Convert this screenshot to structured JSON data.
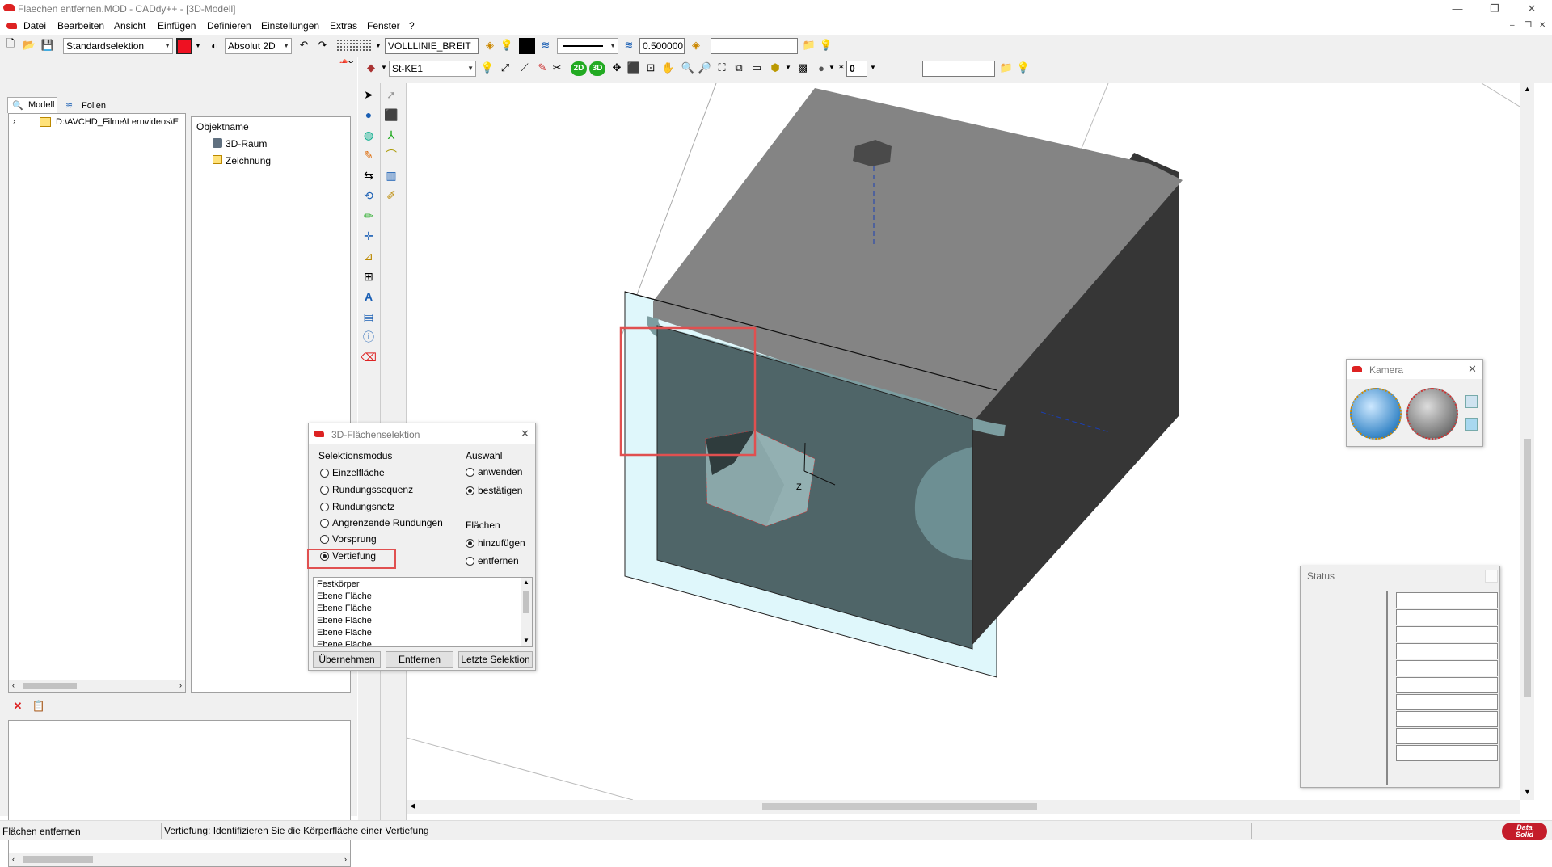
{
  "titlebar": {
    "title": "Flaechen entfernen.MOD  -  CADdy++ - [3D-Modell]",
    "minimize": "—",
    "restore": "❐",
    "close": "✕"
  },
  "menu": [
    "Datei",
    "Bearbeiten",
    "Ansicht",
    "Einfügen",
    "Definieren",
    "Einstellungen",
    "Extras",
    "Fenster",
    "?"
  ],
  "mdi": {
    "minimize": "–",
    "restore": "❐",
    "close": "✕"
  },
  "toolbar1": {
    "selection_mode": "Standardselektion",
    "coord_mode": "Absolut 2D",
    "linetype": "VOLLLINIE_BREIT",
    "linewidth": "0.500000",
    "text_field": ""
  },
  "toolbar2": {
    "layer": "St-KE1",
    "view2d": "2D",
    "view3d": "3D",
    "number": "0",
    "text_field": ""
  },
  "leftpanel": {
    "tabs": [
      "Modell",
      "Folien"
    ],
    "tree_path": "D:\\AVCHD_Filme\\Lernvideos\\E",
    "object_header": "Objektname",
    "objects": [
      "3D-Raum",
      "Zeichnung"
    ]
  },
  "dialog": {
    "title": "3D-Flächenselektion",
    "mode_group": "Selektionsmodus",
    "modes": [
      "Einzelfläche",
      "Rundungssequenz",
      "Rundungsnetz",
      "Angrenzende Rundungen",
      "Vorsprung",
      "Vertiefung"
    ],
    "selected_mode": "Vertiefung",
    "auswahl_group": "Auswahl",
    "auswahl": [
      "anwenden",
      "bestätigen"
    ],
    "auswahl_selected": "bestätigen",
    "flaechen_group": "Flächen",
    "flaechen": [
      "hinzufügen",
      "entfernen"
    ],
    "flaechen_selected": "hinzufügen",
    "list": [
      "Festkörper",
      "Ebene Fläche",
      "Ebene Fläche",
      "Ebene Fläche",
      "Ebene Fläche",
      "Ebene Fläche"
    ],
    "buttons": [
      "Übernehmen",
      "Entfernen",
      "Letzte Selektion"
    ]
  },
  "camera": {
    "title": "Kamera"
  },
  "status_panel": {
    "title": "Status"
  },
  "statusbar": {
    "left": "Flächen entfernen",
    "message": "Vertiefung: Identifizieren Sie die Körperfläche einer Vertiefung",
    "logo_top": "Data",
    "logo_bottom": "Solid"
  },
  "colors": {
    "accent_red": "#e03030",
    "highlight_box": "#e05050",
    "plane_cyan": "#dff7fb",
    "top_face": "#848484",
    "front_face": "#4f6568",
    "side_face": "#363636"
  }
}
